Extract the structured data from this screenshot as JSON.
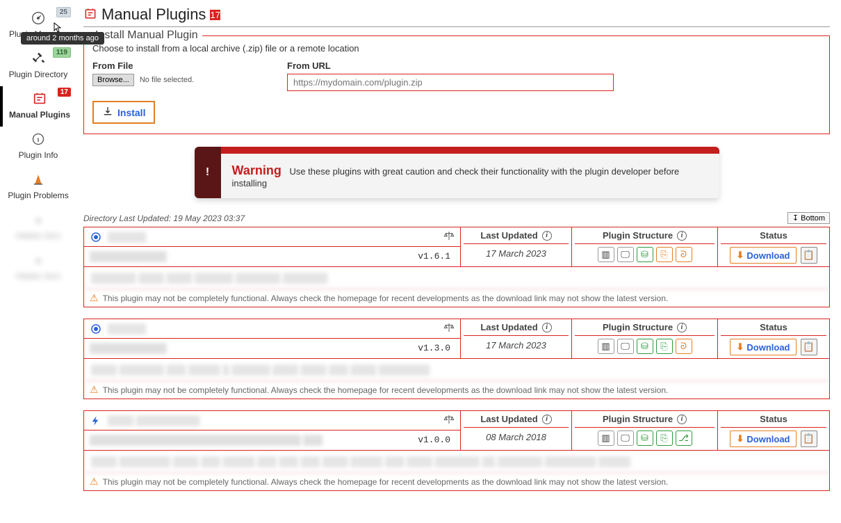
{
  "sidebar": {
    "items": [
      {
        "label": "Plugin Manager",
        "badge": "25",
        "badgeClass": "badge-blue"
      },
      {
        "label": "Plugin Directory",
        "badge": "119",
        "badgeClass": "badge-green"
      },
      {
        "label": "Manual Plugins",
        "badge": "17",
        "badgeClass": "badge-red"
      },
      {
        "label": "Plugin Info"
      },
      {
        "label": "Plugin Problems"
      }
    ]
  },
  "page": {
    "title": "Manual Plugins",
    "badge": "17"
  },
  "install": {
    "legend": "Install Manual Plugin",
    "help": "Choose to install from a local archive (.zip) file or a remote location",
    "fromFileLabel": "From File",
    "browseLabel": "Browse...",
    "noFile": "No file selected.",
    "fromUrlLabel": "From URL",
    "urlPlaceholder": "https://mydomain.com/plugin.zip",
    "installLabel": "Install"
  },
  "warning": {
    "title": "Warning",
    "body": "Use these plugins with great caution and check their functionality with the plugin developer before installing"
  },
  "meta": {
    "lastUpdated": "Directory Last Updated: 19 May 2023 03:37",
    "bottom": "↧ Bottom"
  },
  "headers": {
    "lastUpdated": "Last Updated",
    "structure": "Plugin Structure",
    "status": "Status",
    "download": "Download"
  },
  "tooltip": "around 2 months ago",
  "note": "This plugin may not be completely functional. Always check the homepage for recent developments as the download link may not show the latest version.",
  "plugins": [
    {
      "version": "v1.6.1",
      "date": "17 March 2023",
      "iconColor": "#2962d9",
      "iconShape": "target"
    },
    {
      "version": "v1.3.0",
      "date": "17 March 2023",
      "iconColor": "#2962d9",
      "iconShape": "target"
    },
    {
      "version": "v1.0.0",
      "date": "08 March 2018",
      "iconColor": "#2962d9",
      "iconShape": "bolt"
    }
  ]
}
